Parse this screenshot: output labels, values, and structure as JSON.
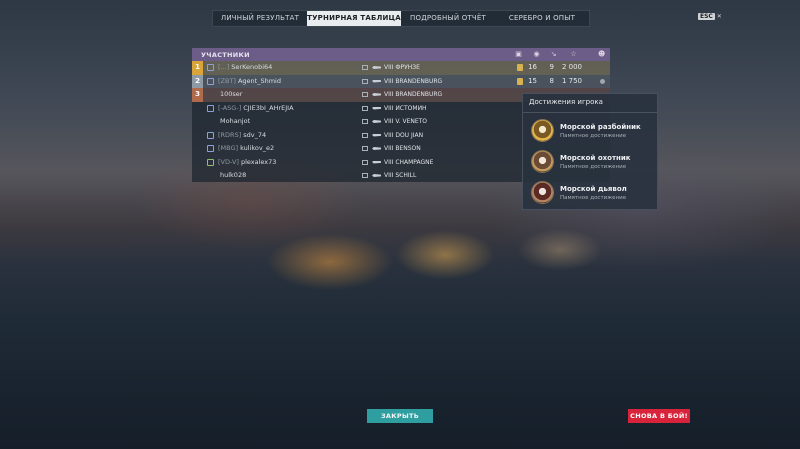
{
  "tabs": [
    {
      "label": "ЛИЧНЫЙ РЕЗУЛЬТАТ",
      "active": false
    },
    {
      "label": "ТУРНИРНАЯ ТАБЛИЦА",
      "active": true
    },
    {
      "label": "ПОДРОБНЫЙ ОТЧЁТ",
      "active": false
    },
    {
      "label": "СЕРЕБРО И ОПЫТ",
      "active": false
    }
  ],
  "esc_key": "ESC",
  "table": {
    "title": "УЧАСТНИКИ",
    "header_icons": [
      "ship-icon",
      "target-icon",
      "sword-icon",
      "star-icon",
      "face-icon"
    ],
    "rows": [
      {
        "rank": "1",
        "tag": "[...]",
        "name": "SerKenobi64",
        "ship": "VIII ФРУНЗЕ",
        "c1": "16",
        "c2": "9",
        "c3": "2 000",
        "has_medal": true
      },
      {
        "rank": "2",
        "tag": "[ZBT]",
        "name": "Agent_Shmid",
        "ship": "VIII BRANDENBURG",
        "c1": "15",
        "c2": "8",
        "c3": "1 750",
        "has_medal": true
      },
      {
        "rank": "3",
        "tag": "",
        "name": "100ser",
        "ship": "VIII BRANDENBURG",
        "c1": "",
        "c2": "",
        "c3": "",
        "has_medal": false
      },
      {
        "rank": "",
        "tag": "[-ASG-]",
        "name": "CJIE3bI_AHrEJIA",
        "ship": "VIII ИСТОМИН",
        "c1": "",
        "c2": "",
        "c3": "",
        "has_medal": true
      },
      {
        "rank": "",
        "tag": "",
        "name": "Mohanjot",
        "ship": "VIII V. VENETO",
        "c1": "",
        "c2": "",
        "c3": "",
        "has_medal": false
      },
      {
        "rank": "",
        "tag": "[RDRS]",
        "name": "sdv_74",
        "ship": "VIII DOU JIAN",
        "c1": "",
        "c2": "",
        "c3": "",
        "has_medal": false
      },
      {
        "rank": "",
        "tag": "[MBG]",
        "name": "kulikov_e2",
        "ship": "VIII BENSON",
        "c1": "",
        "c2": "",
        "c3": "",
        "has_medal": false
      },
      {
        "rank": "",
        "tag": "[VD-V]",
        "name": "plexalex73",
        "ship": "VIII CHAMPAGNE",
        "c1": "",
        "c2": "",
        "c3": "",
        "has_medal": false
      },
      {
        "rank": "",
        "tag": "",
        "name": "hulk028",
        "ship": "VIII SCHILL",
        "c1": "",
        "c2": "",
        "c3": "",
        "has_medal": false
      }
    ]
  },
  "achievements": {
    "title": "Достижения игрока",
    "items": [
      {
        "title": "Морской разбойник",
        "subtitle": "Памятное достижение",
        "icon": "pirate-skull-badge-icon"
      },
      {
        "title": "Морской охотник",
        "subtitle": "Памятное достижение",
        "icon": "hunter-skull-badge-icon"
      },
      {
        "title": "Морской дьявол",
        "subtitle": "Памятное достижение",
        "icon": "devil-skull-badge-icon"
      }
    ]
  },
  "buttons": {
    "close": "ЗАКРЫТЬ",
    "battle": "СНОВА В БОЙ!"
  },
  "colors": {
    "header_purple": "#78669a",
    "close_teal": "#2f9ea0",
    "battle_red": "#d8243a",
    "rank_gold": "#d9a43a"
  }
}
